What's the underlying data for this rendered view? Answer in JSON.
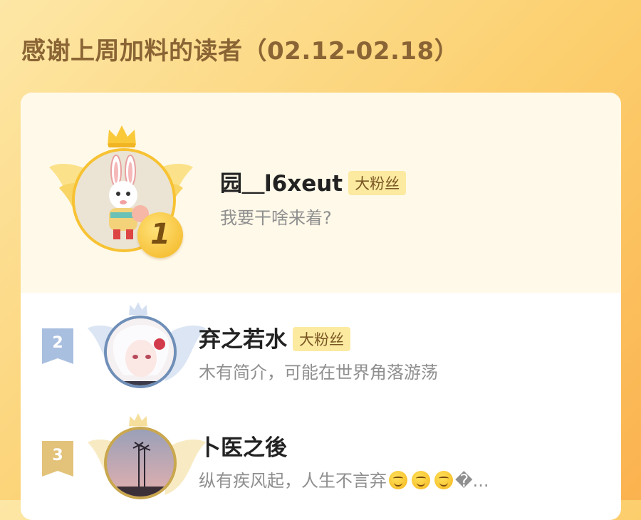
{
  "header": {
    "title": "感谢上周加料的读者（02.12-02.18）"
  },
  "readers": [
    {
      "rank": "1",
      "name": "园＿l6xeut",
      "badge": "大粉丝",
      "desc": "我要干啥来着?"
    },
    {
      "rank": "2",
      "name": "弃之若水",
      "badge": "大粉丝",
      "desc": "木有简介，可能在世界角落游荡"
    },
    {
      "rank": "3",
      "name": "卜医之後",
      "desc": "纵有疾风起，人生不言弃",
      "desc_tail": "�..."
    }
  ],
  "icons": {
    "first_rank": "gold-medal-icon",
    "crown": "crown-icon",
    "wings": "wings-icon",
    "emoji": "smiling-face-emoji-icon"
  },
  "colors": {
    "title": "#8a6434",
    "badge_bg": "#fbeaa0",
    "badge_text": "#7a5623",
    "gold": "#f7c233",
    "silver": "#a9bfe0",
    "bronze": "#e3c27a"
  }
}
